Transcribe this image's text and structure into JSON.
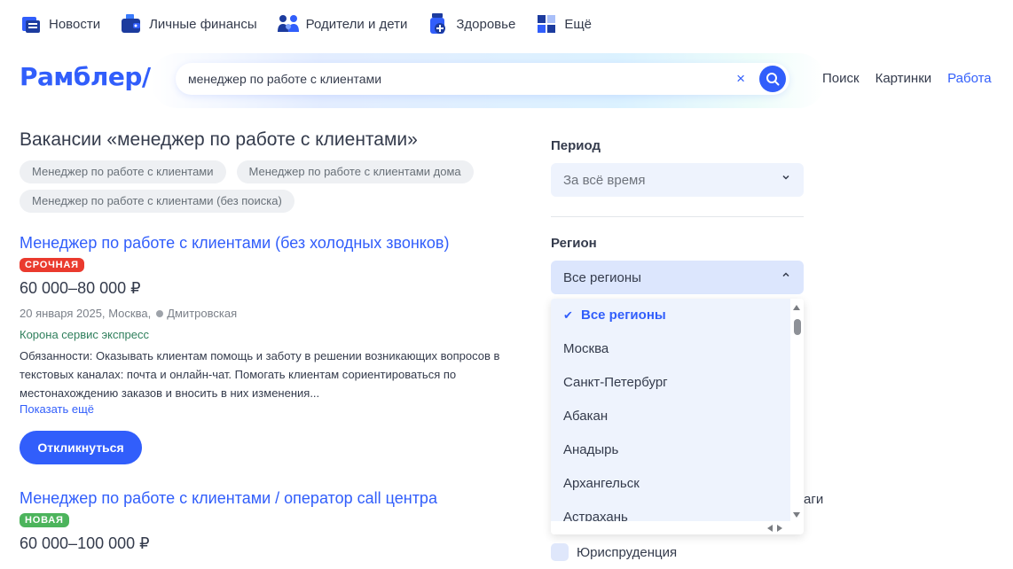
{
  "topnav": [
    {
      "label": "Новости",
      "icon": "news-icon"
    },
    {
      "label": "Личные финансы",
      "icon": "wallet-icon"
    },
    {
      "label": "Родители и дети",
      "icon": "family-icon"
    },
    {
      "label": "Здоровье",
      "icon": "health-icon"
    },
    {
      "label": "Ещё",
      "icon": "more-grid-icon"
    }
  ],
  "header": {
    "logo": "Рамблер/",
    "search_value": "менеджер по работе с клиентами",
    "clear_label": "×",
    "links": [
      {
        "label": "Поиск",
        "active": false
      },
      {
        "label": "Картинки",
        "active": false
      },
      {
        "label": "Работа",
        "active": true
      }
    ]
  },
  "main": {
    "title": "Вакансии «менеджер по работе с клиентами»",
    "chips": [
      "Менеджер по работе с клиентами",
      "Менеджер по работе с клиентами дома",
      "Менеджер по работе с клиентами (без поиска)"
    ],
    "vacancies": [
      {
        "title": "Менеджер по работе с клиентами (без холодных звонков)",
        "badge": "СРОЧНАЯ",
        "salary": "60 000–80 000 ₽",
        "date": "20 января 2025,",
        "city": "Москва,",
        "metro": "Дмитровская",
        "company": "Корона сервис экспресс",
        "description": "Обязанности: Оказывать клиентам помощь и заботу в решении возникающих вопросов в текстовых каналах: почта и онлайн-чат. Помогать клиентам сориентироваться по местонахождению заказов и вносить в них изменения...",
        "more": "Показать ещё",
        "respond": "Откликнуться"
      },
      {
        "title": "Менеджер по работе с клиентами / оператор call центра",
        "badge": "НОВАЯ",
        "salary": "60 000–100 000 ₽"
      }
    ]
  },
  "filters": {
    "period_label": "Период",
    "period_value": "За всё время",
    "region_label": "Регион",
    "region_value": "Все регионы",
    "region_options": [
      "Все регионы",
      "Москва",
      "Санкт-Петербург",
      "Абакан",
      "Анадырь",
      "Архангельск",
      "Астрахань"
    ],
    "partial_text": "аги",
    "checkbox_label": "Юриспруденция"
  },
  "colors": {
    "accent": "#315efb",
    "urgent": "#ea3a2e",
    "new": "#4cb45c",
    "company": "#2f7f5c"
  }
}
